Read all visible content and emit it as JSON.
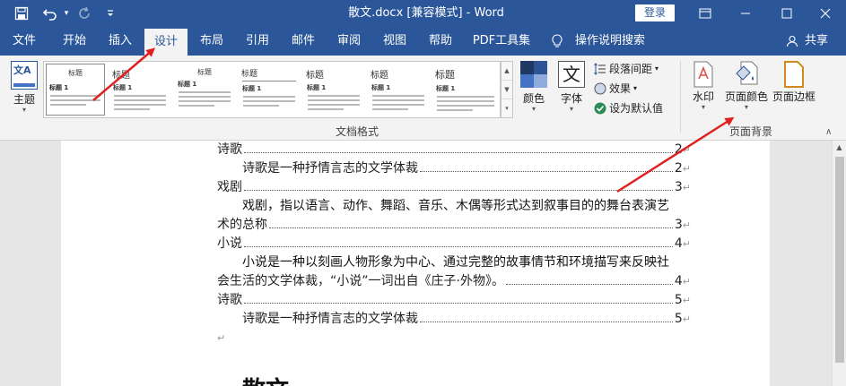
{
  "window": {
    "title": "散文.docx [兼容模式]  -  Word",
    "login_label": "登录"
  },
  "quick_access": {
    "icons": [
      "save-icon",
      "undo-icon",
      "redo-icon",
      "customize-icon"
    ]
  },
  "tabs": [
    {
      "label": "文件"
    },
    {
      "label": "开始"
    },
    {
      "label": "插入"
    },
    {
      "label": "设计",
      "active": true
    },
    {
      "label": "布局"
    },
    {
      "label": "引用"
    },
    {
      "label": "邮件"
    },
    {
      "label": "审阅"
    },
    {
      "label": "视图"
    },
    {
      "label": "帮助"
    },
    {
      "label": "PDF工具集"
    },
    {
      "label": "操作说明搜索"
    }
  ],
  "share_label": "共享",
  "ribbon": {
    "theme_label": "主题",
    "gallery": {
      "thumb1_title": "标题",
      "thumb1_heading": "标题 1",
      "thumb_title": "标题",
      "thumb_heading": "标题 1"
    },
    "colors_label": "颜色",
    "fonts_label": "字体",
    "fonts_icon_glyph": "文",
    "theme_icon_glyph": "文A",
    "paragraph_spacing_label": "段落间距",
    "effects_label": "效果",
    "set_default_label": "设为默认值",
    "doc_format_group": "文档格式",
    "watermark_label": "水印",
    "page_color_label": "页面颜色",
    "page_borders_label": "页面边框",
    "page_background_group": "页面背景"
  },
  "document": {
    "rows": [
      {
        "text": "诗歌",
        "page": "2",
        "indent": false
      },
      {
        "text": "诗歌是一种抒情言志的文学体裁",
        "page": "2",
        "indent": true
      },
      {
        "text": "戏剧",
        "page": "3",
        "indent": false
      }
    ],
    "para1_line1": "戏剧，指以语言、动作、舞蹈、音乐、木偶等形式达到叙事目的的舞台表演艺",
    "para1_line2": "术的总称",
    "para1_page": "3",
    "row_novel": {
      "text": "小说",
      "page": "4"
    },
    "para2_line1": "小说是一种以刻画人物形象为中心、通过完整的故事情节和环境描写来反映社",
    "para2_line2": "会生活的文学体裁，“小说”一词出自《庄子·外物》。",
    "para2_page": "4",
    "rows2": [
      {
        "text": "诗歌",
        "page": "5",
        "indent": false
      },
      {
        "text": "诗歌是一种抒情言志的文学体裁",
        "page": "5",
        "indent": true
      }
    ],
    "heading": "散文",
    "para_mark": "↵"
  },
  "colors": {
    "title_bar": "#2b579a",
    "ribbon": "#f3f3f3",
    "arrow": "#e02020"
  }
}
